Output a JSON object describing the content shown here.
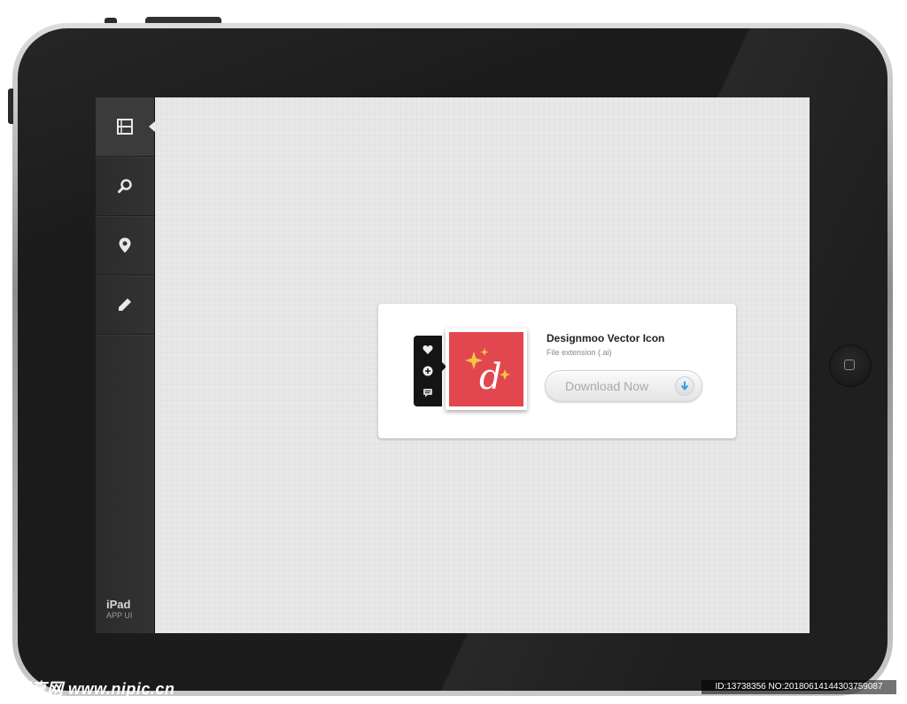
{
  "sidebar": {
    "items": [
      {
        "icon": "film-icon",
        "active": true
      },
      {
        "icon": "search-icon",
        "active": false
      },
      {
        "icon": "location-pin-icon",
        "active": false
      },
      {
        "icon": "pencil-icon",
        "active": false
      }
    ],
    "brand_title": "iPad",
    "brand_subtitle": "APP UI"
  },
  "card": {
    "title": "Designmoo Vector Icon",
    "subtitle": "File extension (.ai)",
    "download_label": "Download Now",
    "actions": [
      "heart-icon",
      "plus-icon",
      "comment-icon"
    ],
    "thumbnail_letter": "d",
    "thumbnail_color": "#e2474f",
    "sparkle_color": "#f5c542"
  },
  "watermark": {
    "left": "昵享网 www.nipic.cn",
    "right": "ID:13738356 NO:20180614144303759087"
  }
}
